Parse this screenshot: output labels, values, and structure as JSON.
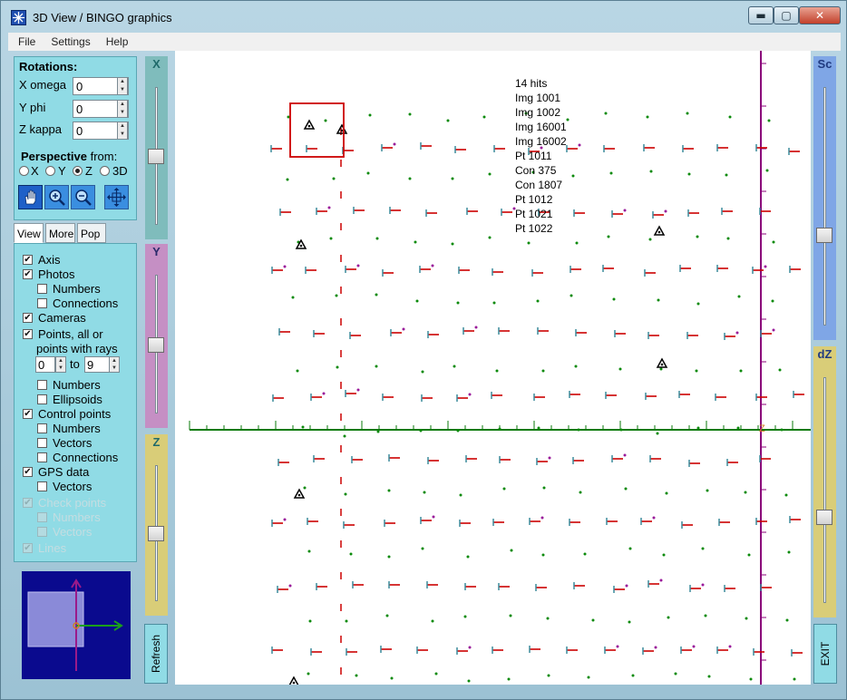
{
  "window": {
    "title": "3D View / BINGO graphics",
    "min_label": "▬",
    "max_label": "▢",
    "close_label": "✕"
  },
  "menu": [
    {
      "label": "File"
    },
    {
      "label": "Settings"
    },
    {
      "label": "Help"
    }
  ],
  "rotations": {
    "title": "Rotations:",
    "fields": [
      {
        "label": "X omega",
        "value": "0"
      },
      {
        "label": "Y phi",
        "value": "0"
      },
      {
        "label": "Z kappa",
        "value": "0"
      }
    ],
    "perspective_bold": "Perspective",
    "perspective_rest": " from:",
    "radios": [
      {
        "label": "X"
      },
      {
        "label": "Y"
      },
      {
        "label": "Z",
        "selected": true
      },
      {
        "label": "3D"
      }
    ],
    "tools": [
      "hand-icon",
      "zoom-in-icon",
      "zoom-out-icon",
      "fit-view-icon"
    ]
  },
  "tabs": [
    {
      "label": "View",
      "active": true
    },
    {
      "label": "More"
    },
    {
      "label": "Pop"
    }
  ],
  "view_options": [
    {
      "label": "Axis",
      "checked": true,
      "indent": 0
    },
    {
      "label": "Photos",
      "checked": true,
      "indent": 0
    },
    {
      "label": "Numbers",
      "checked": false,
      "indent": 1
    },
    {
      "label": "Connections",
      "checked": false,
      "indent": 1
    },
    {
      "label": "Cameras",
      "checked": true,
      "indent": 0
    },
    {
      "label": "Points, all or",
      "checked": true,
      "indent": 0
    },
    {
      "label": "Numbers",
      "checked": false,
      "indent": 1
    },
    {
      "label": "Ellipsoids",
      "checked": false,
      "indent": 1
    },
    {
      "label": "Control points",
      "checked": true,
      "indent": 0
    },
    {
      "label": "Numbers",
      "checked": false,
      "indent": 1
    },
    {
      "label": "Vectors",
      "checked": false,
      "indent": 1
    },
    {
      "label": "Connections",
      "checked": false,
      "indent": 1
    },
    {
      "label": "GPS data",
      "checked": true,
      "indent": 0
    },
    {
      "label": "Vectors",
      "checked": false,
      "indent": 1
    },
    {
      "label": "Check points",
      "checked": true,
      "indent": 0,
      "disabled": true
    },
    {
      "label": "Numbers",
      "checked": false,
      "indent": 1,
      "disabled": true
    },
    {
      "label": "Vectors",
      "checked": false,
      "indent": 1,
      "disabled": true
    },
    {
      "label": "Lines",
      "checked": true,
      "indent": 0,
      "disabled": true
    }
  ],
  "rays": {
    "label": "points with rays",
    "from": "0",
    "to_label": "to",
    "to": "9"
  },
  "sliders": {
    "x": {
      "label": "X",
      "color": "#7fbcbc",
      "value": 0.5
    },
    "y": {
      "label": "Y",
      "color": "#c58fc4",
      "value": 0.5
    },
    "z": {
      "label": "Z",
      "color": "#d9cd78",
      "value": 0.5
    },
    "sc": {
      "label": "Sc",
      "color": "#7fa6e6",
      "value": 0.62
    },
    "dz": {
      "label": "dZ",
      "color": "#d9cd78",
      "value": 0.62
    }
  },
  "buttons": {
    "refresh": "Refresh",
    "exit": "EXIT"
  },
  "hits": [
    "14 hits",
    "Img 1001",
    "Img 1002",
    "Img 16001",
    "Img 16002",
    "Pt 1011",
    "Con 375",
    "Con 1807",
    "Pt 1012",
    "Pt 1021",
    "Pt 1022"
  ],
  "colors": {
    "axis_x": "#0a7a0a",
    "axis_y": "#8a007a",
    "camera": "#cc0000",
    "point": "#0a8a0a",
    "control_point": "#000000",
    "selection": "#cc0000"
  }
}
